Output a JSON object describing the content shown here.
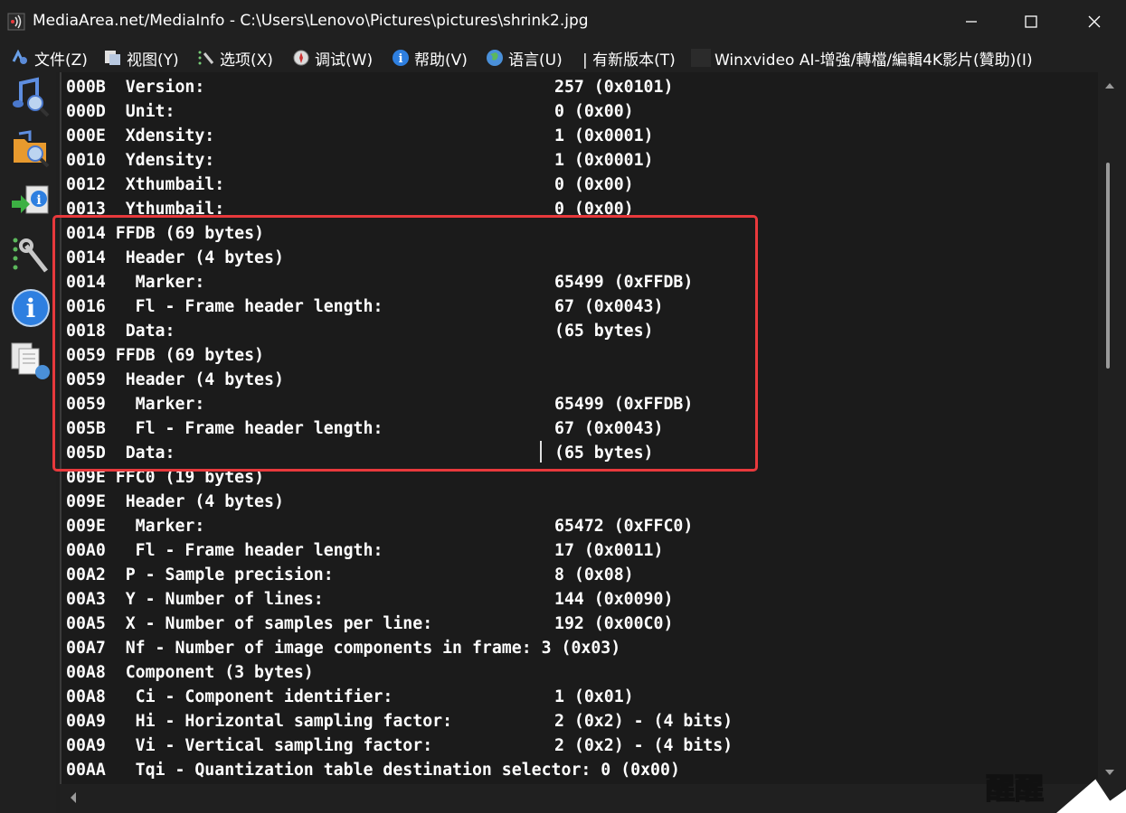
{
  "window": {
    "title": "MediaArea.net/MediaInfo - C:\\Users\\Lenovo\\Pictures\\pictures\\shrink2.jpg"
  },
  "menu": {
    "items": [
      {
        "label": "文件(Z)",
        "icon": "file-icon"
      },
      {
        "label": "视图(Y)",
        "icon": "view-icon"
      },
      {
        "label": "选项(X)",
        "icon": "options-icon"
      },
      {
        "label": "调试(W)",
        "icon": "debug-icon"
      },
      {
        "label": "帮助(V)",
        "icon": "help-icon"
      },
      {
        "label": "语言(U)",
        "icon": "language-icon"
      },
      {
        "label": "| 有新版本(T)",
        "icon": ""
      },
      {
        "label": "Winxvideo AI-增強/轉檔/編輯4K影片(贊助)(I)",
        "icon": "sponsor-icon"
      }
    ]
  },
  "toolbar": {
    "buttons": [
      "open-file-icon",
      "open-folder-icon",
      "export-icon",
      "preferences-icon",
      "about-icon",
      "sheet-view-icon"
    ]
  },
  "lines": [
    {
      "offset": "000B",
      "label": "  Version:",
      "value": "257 (0x0101)"
    },
    {
      "offset": "000D",
      "label": "  Unit:",
      "value": "0 (0x00)"
    },
    {
      "offset": "000E",
      "label": "  Xdensity:",
      "value": "1 (0x0001)"
    },
    {
      "offset": "0010",
      "label": "  Ydensity:",
      "value": "1 (0x0001)"
    },
    {
      "offset": "0012",
      "label": "  Xthumbail:",
      "value": "0 (0x00)"
    },
    {
      "offset": "0013",
      "label": "  Ythumbail:",
      "value": "0 (0x00)"
    },
    {
      "offset": "0014",
      "label": " FFDB (69 bytes)",
      "value": ""
    },
    {
      "offset": "0014",
      "label": "  Header (4 bytes)",
      "value": ""
    },
    {
      "offset": "0014",
      "label": "   Marker:",
      "value": "65499 (0xFFDB)"
    },
    {
      "offset": "0016",
      "label": "   Fl - Frame header length:",
      "value": "67 (0x0043)"
    },
    {
      "offset": "0018",
      "label": "  Data:",
      "value": "(65 bytes)"
    },
    {
      "offset": "0059",
      "label": " FFDB (69 bytes)",
      "value": ""
    },
    {
      "offset": "0059",
      "label": "  Header (4 bytes)",
      "value": ""
    },
    {
      "offset": "0059",
      "label": "   Marker:",
      "value": "65499 (0xFFDB)"
    },
    {
      "offset": "005B",
      "label": "   Fl - Frame header length:",
      "value": "67 (0x0043)"
    },
    {
      "offset": "005D",
      "label": "  Data:",
      "value": "(65 bytes)"
    },
    {
      "offset": "009E",
      "label": " FFC0 (19 bytes)",
      "value": ""
    },
    {
      "offset": "009E",
      "label": "  Header (4 bytes)",
      "value": ""
    },
    {
      "offset": "009E",
      "label": "   Marker:",
      "value": "65472 (0xFFC0)"
    },
    {
      "offset": "00A0",
      "label": "   Fl - Frame header length:",
      "value": "17 (0x0011)"
    },
    {
      "offset": "00A2",
      "label": "  P - Sample precision:",
      "value": "8 (0x08)"
    },
    {
      "offset": "00A3",
      "label": "  Y - Number of lines:",
      "value": "144 (0x0090)"
    },
    {
      "offset": "00A5",
      "label": "  X - Number of samples per line:",
      "value": "192 (0x00C0)"
    },
    {
      "offset": "00A7",
      "label": "  Nf - Number of image components in frame: 3 (0x03)",
      "value": ""
    },
    {
      "offset": "00A8",
      "label": "  Component (3 bytes)",
      "value": ""
    },
    {
      "offset": "00A8",
      "label": "   Ci - Component identifier:",
      "value": "1 (0x01)"
    },
    {
      "offset": "00A9",
      "label": "   Hi - Horizontal sampling factor:",
      "value": "2 (0x2) - (4 bits)"
    },
    {
      "offset": "00A9",
      "label": "   Vi - Vertical sampling factor:",
      "value": "2 (0x2) - (4 bits)"
    },
    {
      "offset": "00AA",
      "label": "   Tqi - Quantization table destination selector: 0 (0x00)",
      "value": ""
    }
  ],
  "watermark": "醒醒",
  "colors": {
    "highlight": "#e8393c",
    "background": "#1b1b1b",
    "text": "#ffffff"
  }
}
